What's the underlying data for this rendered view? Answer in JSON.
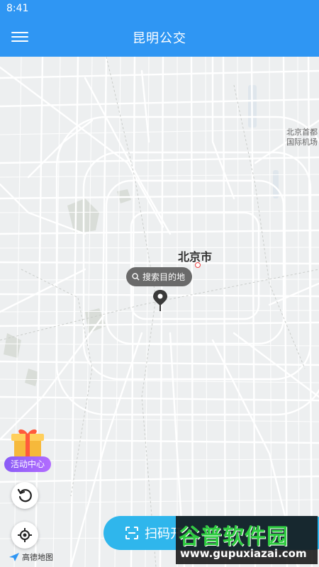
{
  "status_bar": {
    "time": "8:41"
  },
  "app_bar": {
    "title": "昆明公交"
  },
  "map": {
    "city_label": "北京市",
    "airport_label_line1": "北京首都",
    "airport_label_line2": "国际机场",
    "search_placeholder": "搜索目的地",
    "provider": "高德地图"
  },
  "floating": {
    "activity_label": "活动中心",
    "scan_label": "扫码开"
  },
  "watermark": {
    "brand": "谷普软件园",
    "url": "www.gupuxiazai.com"
  },
  "colors": {
    "primary": "#2f96f3",
    "scan_button": "#2fb6ec",
    "activity_purple": "#8a5cf6"
  }
}
